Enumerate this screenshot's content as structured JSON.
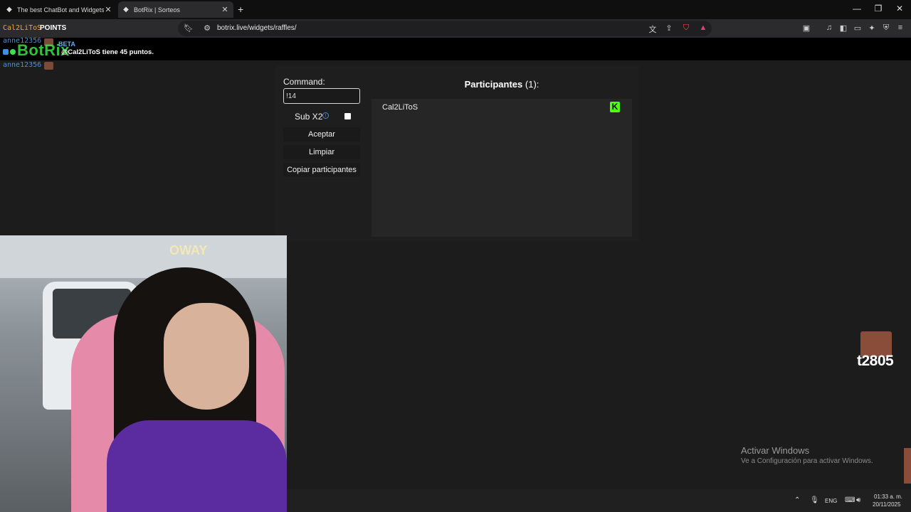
{
  "browser": {
    "tabs": [
      {
        "label": "The best ChatBot and Widgets for Ki",
        "active": false
      },
      {
        "label": "BotRix | Sorteos",
        "active": true
      }
    ],
    "url": "botrix.live/widgets/raffles/",
    "window_controls": [
      "minimize",
      "restore",
      "close"
    ]
  },
  "overlay": {
    "points_user": "Cal2LiToS",
    "points_label": "POINTS",
    "chat_users": [
      "anne12356 :",
      "anne12356 :"
    ],
    "logo": "BotRix",
    "beta": "BETA",
    "chat_message": "@Cal2LiToS tiene 45 puntos.",
    "streak_text": "t2805",
    "accent_green": "#53fc18"
  },
  "raffle": {
    "command_label": "Command:",
    "command_value": "!14",
    "sub_label": "Sub X2",
    "sub_checked": false,
    "buttons": {
      "accept": "Aceptar",
      "clear": "Limpiar",
      "copy": "Copiar participantes"
    },
    "participants_title": "Participantes",
    "participants_count": "(1):",
    "participants": [
      {
        "name": "Cal2LiToS",
        "platform": "kick-icon"
      }
    ]
  },
  "webcam": {
    "shirt_text": "OWAY"
  },
  "windows": {
    "activate_title": "Activar Windows",
    "activate_sub": "Ve a Configuración para activar Windows.",
    "tray_lang": "ENG",
    "time": "01:33 a. m.",
    "date": "20/11/2025"
  }
}
